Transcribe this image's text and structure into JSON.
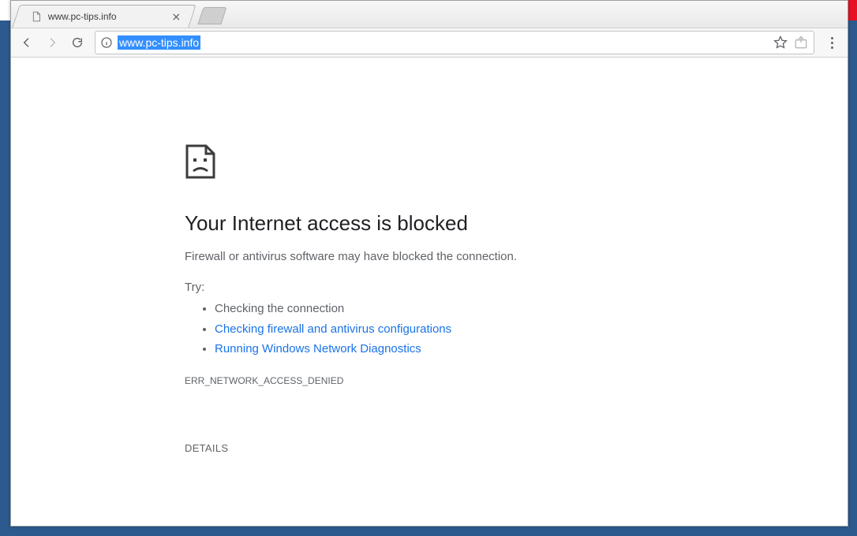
{
  "window": {
    "controls": {
      "user": "user-icon",
      "minimize": "minimize",
      "maximize": "maximize",
      "close": "close"
    }
  },
  "browser": {
    "tab": {
      "title": "www.pc-tips.info"
    },
    "omnibox": {
      "info_icon": "info-icon",
      "url": "www.pc-tips.info",
      "url_selected": true
    }
  },
  "error_page": {
    "heading": "Your Internet access is blocked",
    "subtitle": "Firewall or antivirus software may have blocked the connection.",
    "try_label": "Try:",
    "suggestions": [
      {
        "text": "Checking the connection",
        "link": false
      },
      {
        "text": "Checking firewall and antivirus configurations",
        "link": true
      },
      {
        "text": "Running Windows Network Diagnostics",
        "link": true
      }
    ],
    "error_code": "ERR_NETWORK_ACCESS_DENIED",
    "details_button": "DETAILS"
  }
}
